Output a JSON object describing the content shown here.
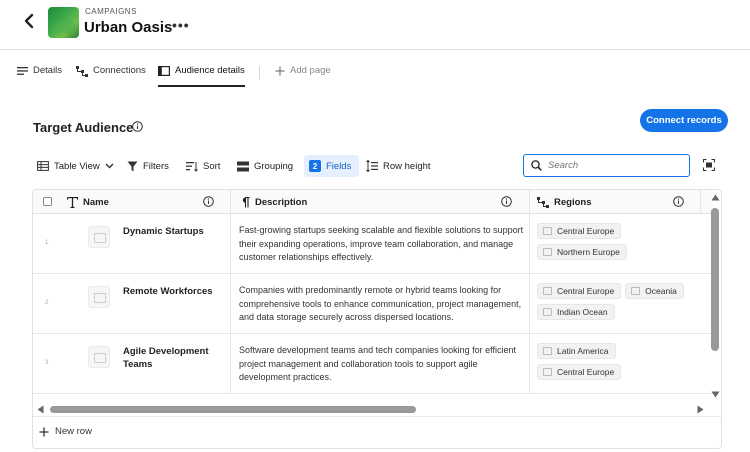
{
  "header": {
    "breadcrumb": "CAMPAIGNS",
    "title": "Urban Oasis",
    "more_label": "•••"
  },
  "tabs": [
    {
      "label": "Details",
      "icon": "list-icon"
    },
    {
      "label": "Connections",
      "icon": "connections-icon"
    },
    {
      "label": "Audience details",
      "icon": "table-icon",
      "active": true
    },
    {
      "label": "Add page",
      "icon": "plus-icon"
    }
  ],
  "section": {
    "title": "Target Audience",
    "connect_button": "Connect records"
  },
  "toolbar": {
    "table_view": "Table View",
    "filters": "Filters",
    "sort": "Sort",
    "grouping": "Grouping",
    "fields_count": "2",
    "fields": "Fields",
    "row_height": "Row height"
  },
  "search": {
    "placeholder": "Search"
  },
  "table": {
    "columns": [
      "Name",
      "Description",
      "Regions"
    ],
    "rows": [
      {
        "num": "1",
        "name": "Dynamic Startups",
        "description": "Fast-growing startups seeking scalable and flexible solutions to support their expanding operations, improve team collaboration, and manage customer relationships effectively.",
        "regions": [
          "Central Europe",
          "Northern Europe"
        ]
      },
      {
        "num": "2",
        "name": "Remote Workforces",
        "description": "Companies with predominantly remote or hybrid teams looking for comprehensive tools to enhance communication, project management, and data storage securely across dispersed locations.",
        "regions": [
          "Central Europe",
          "Oceania",
          "Indian Ocean"
        ]
      },
      {
        "num": "3",
        "name": "Agile Development Teams",
        "description": "Software development teams and tech companies looking for efficient project management and collaboration tools to support agile development practices.",
        "regions": [
          "Latin America",
          "Central Europe"
        ]
      }
    ],
    "new_row": "New row"
  },
  "colors": {
    "accent": "#1473e6",
    "fields_bg": "#e5f0fe"
  }
}
